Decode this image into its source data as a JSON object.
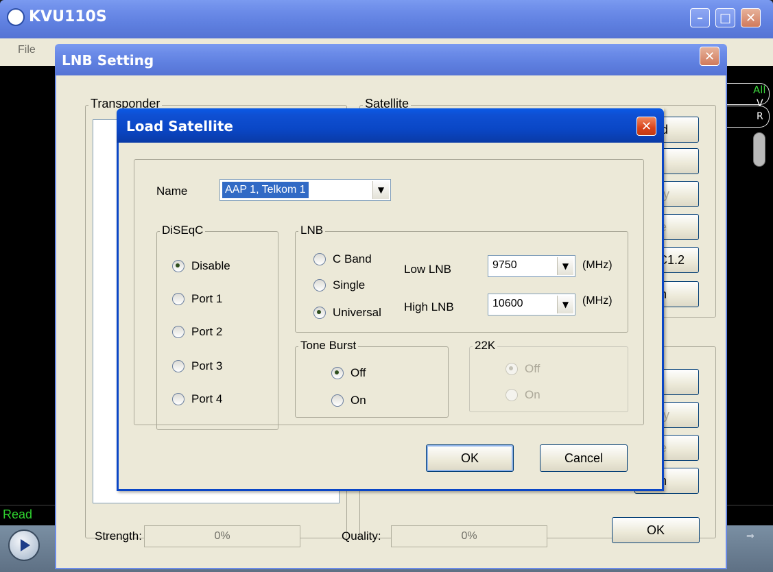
{
  "main_window": {
    "title": "KVU110S",
    "menu_file": "File",
    "status_text": "Read",
    "right_panel": {
      "all_label": "All",
      "v_label": "V",
      "r_label": "R"
    }
  },
  "lnb_setting": {
    "title": "LNB Setting",
    "transponder_legend": "Transponder",
    "satellite_legend": "Satellite",
    "satellite_buttons_partial": [
      "d",
      "",
      "fy",
      "e",
      "C1.2",
      "n"
    ],
    "transponder_buttons_partial": [
      "",
      "fy",
      "e",
      "n"
    ],
    "strength_label": "Strength:",
    "strength_value": "0%",
    "quality_label": "Quality:",
    "quality_value": "0%",
    "ok_label": "OK"
  },
  "load_satellite": {
    "title": "Load Satellite",
    "name_label": "Name",
    "name_value": "AAP 1, Telkom 1",
    "diseqc": {
      "legend": "DiSEqC",
      "options": [
        "Disable",
        "Port 1",
        "Port 2",
        "Port 3",
        "Port 4"
      ],
      "selected": "Disable"
    },
    "lnb": {
      "legend": "LNB",
      "options": [
        "C Band",
        "Single",
        "Universal"
      ],
      "selected": "Universal",
      "low_label": "Low LNB",
      "low_value": "9750",
      "high_label": "High LNB",
      "high_value": "10600",
      "unit": "(MHz)"
    },
    "tone_burst": {
      "legend": "Tone Burst",
      "options": [
        "Off",
        "On"
      ],
      "selected": "Off"
    },
    "k22": {
      "legend": "22K",
      "options": [
        "Off",
        "On"
      ],
      "selected": "Off",
      "disabled": true
    },
    "ok_label": "OK",
    "cancel_label": "Cancel"
  }
}
